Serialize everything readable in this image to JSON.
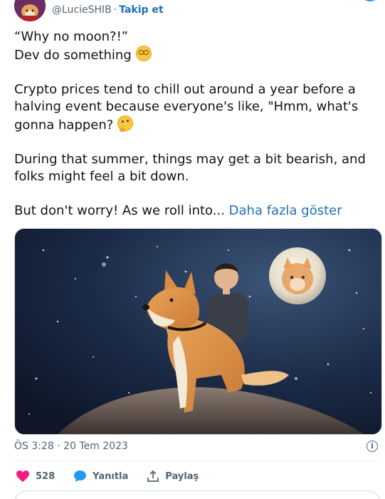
{
  "header": {
    "handle": "@LucieSHIB",
    "separator": "·",
    "follow_label": "Takip et"
  },
  "tweet": {
    "paragraph1_line1": "“Why no moon?!”",
    "paragraph1_line2": "Dev do something",
    "paragraph2": "Crypto prices tend to chill out around a year before a halving event because everyone's like, \"Hmm, what's gonna happen?",
    "paragraph3": "During that summer, things may get a bit bearish, and folks might feel a bit down.",
    "paragraph4": "But don't worry! As we roll into...",
    "show_more": "Daha fazla göster"
  },
  "meta": {
    "timestamp": "ÖS 3:28 · 20 Tem 2023"
  },
  "actions": {
    "like_count": "528",
    "reply_label": "Yanıtla",
    "share_label": "Paylaş"
  },
  "colors": {
    "like": "#f91880",
    "reply": "#1d9bf0",
    "link": "#1d6fb8"
  },
  "icons": {
    "like": "heart-icon",
    "reply": "chat-bubble-icon",
    "share": "share-icon",
    "info": "info-icon"
  }
}
